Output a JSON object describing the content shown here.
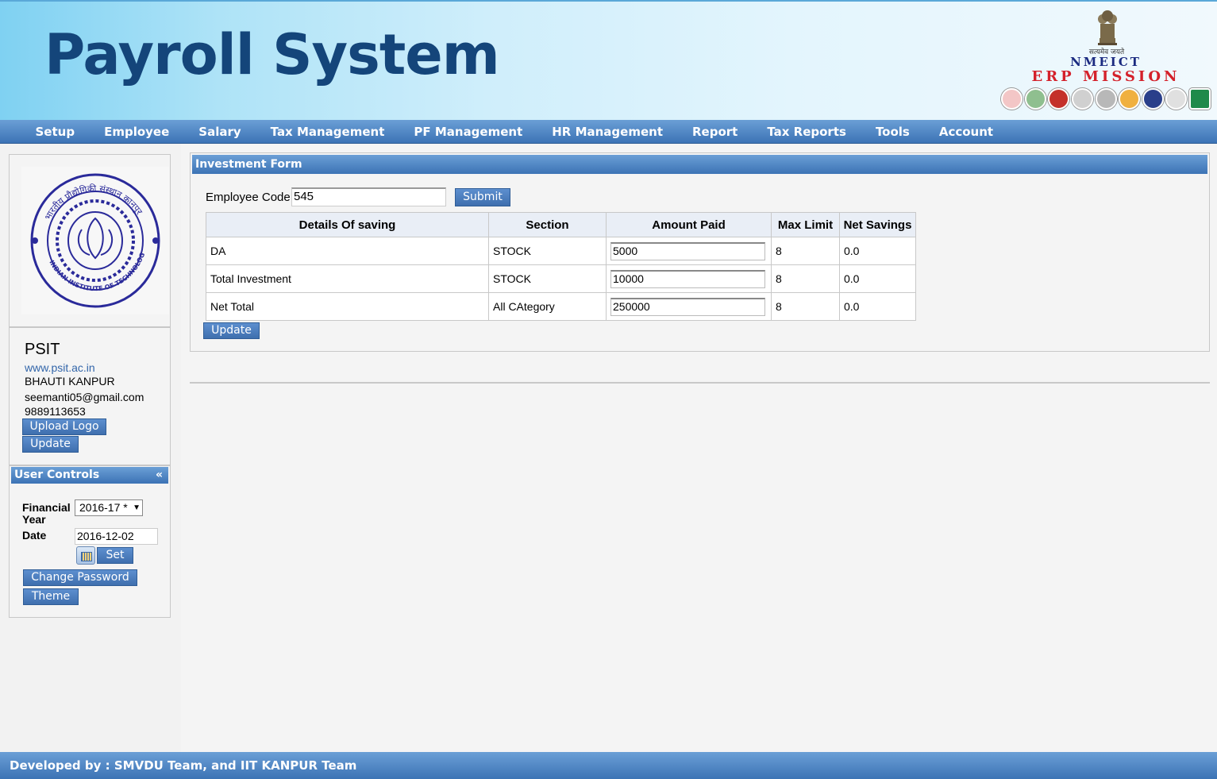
{
  "header": {
    "title": "Payroll System",
    "motto": "सत्यमेव जयते",
    "nmeict": "NMEICT",
    "erp_mission": "ERP MISSION"
  },
  "nav": {
    "items": [
      {
        "label": "Setup"
      },
      {
        "label": "Employee"
      },
      {
        "label": "Salary"
      },
      {
        "label": "Tax Management"
      },
      {
        "label": "PF Management"
      },
      {
        "label": "HR Management"
      },
      {
        "label": "Report"
      },
      {
        "label": "Tax Reports"
      },
      {
        "label": "Tools"
      },
      {
        "label": "Account"
      }
    ]
  },
  "sidebar": {
    "org": {
      "name": "PSIT",
      "url": "www.psit.ac.in",
      "address": "BHAUTI KANPUR",
      "email": "seemanti05@gmail.com",
      "phone": "9889113653"
    },
    "upload_logo_label": "Upload Logo",
    "update_label": "Update",
    "user_controls": {
      "title": "User Controls",
      "collapse": "«",
      "financial_year_label_1": "Financial",
      "financial_year_label_2": "Year",
      "financial_year_value": "2016-17 *",
      "date_label": "Date",
      "date_value": "2016-12-02",
      "set_label": "Set",
      "change_password_label": "Change Password",
      "theme_label": "Theme"
    }
  },
  "form": {
    "title": "Investment Form",
    "employee_code_label": "Employee Code",
    "employee_code_value": "545",
    "submit_label": "Submit",
    "update_label": "Update",
    "columns": [
      "Details Of saving",
      "Section",
      "Amount Paid",
      "Max Limit",
      "Net Savings"
    ],
    "rows": [
      {
        "details": "DA",
        "section": "STOCK",
        "amount": "5000",
        "max_limit": "8",
        "net_savings": "0.0"
      },
      {
        "details": "Total Investment",
        "section": "STOCK",
        "amount": "10000",
        "max_limit": "8",
        "net_savings": "0.0"
      },
      {
        "details": "Net Total",
        "section": "All CAtegory",
        "amount": "250000",
        "max_limit": "8",
        "net_savings": "0.0"
      }
    ]
  },
  "footer": {
    "text": "Developed by : SMVDU Team, and IIT KANPUR Team"
  },
  "colors": {
    "header_title": "#14457a",
    "bar_top": "#6b9fd6",
    "bar_bottom": "#3c73b5",
    "erp_red": "#d4202a",
    "nmeict_blue": "#1a2a80",
    "link": "#3366aa"
  }
}
